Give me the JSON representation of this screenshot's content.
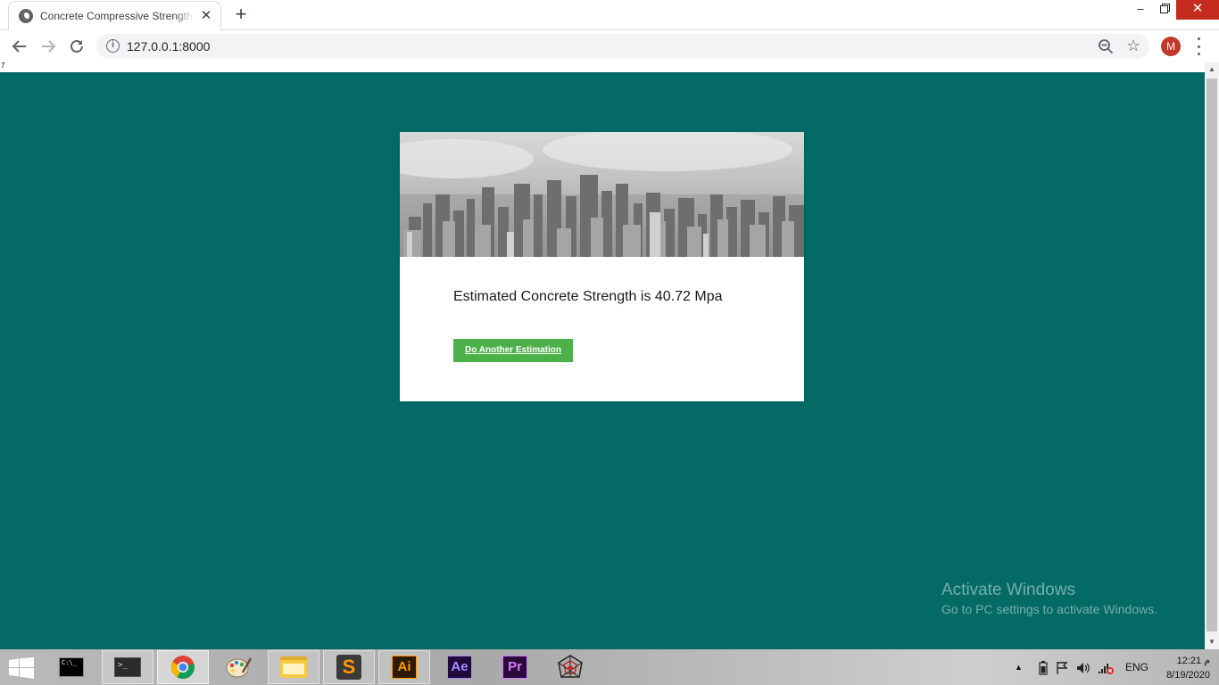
{
  "browser": {
    "tab_title": "Concrete Compressive Strength Prediction",
    "tab_close": "✕",
    "new_tab": "+",
    "url": "127.0.0.1:8000",
    "profile_initial": "M",
    "window_min": "–",
    "window_close": "✕"
  },
  "page": {
    "stray_text": "7",
    "result_text": "Estimated Concrete Strength is 40.72 Mpa",
    "button_label": "Do Another Estimation",
    "background_color": "#036a66",
    "button_color": "#4db14a"
  },
  "watermark": {
    "heading": "Activate Windows",
    "subtext": "Go to PC settings to activate Windows."
  },
  "taskbar": {
    "apps": [
      "command-prompt",
      "terminal",
      "chrome",
      "paint",
      "file-explorer",
      "sublime-text",
      "illustrator",
      "after-effects",
      "premiere-pro",
      "spider-app"
    ],
    "cmd_label": "C:\\_",
    "term_label": ">_",
    "ai_label": "Ai",
    "ae_label": "Ae",
    "pr_label": "Pr",
    "subl_label": "S",
    "tray_arrow": "▲",
    "language": "ENG",
    "time": "12:21 م",
    "date": "8/19/2020"
  }
}
